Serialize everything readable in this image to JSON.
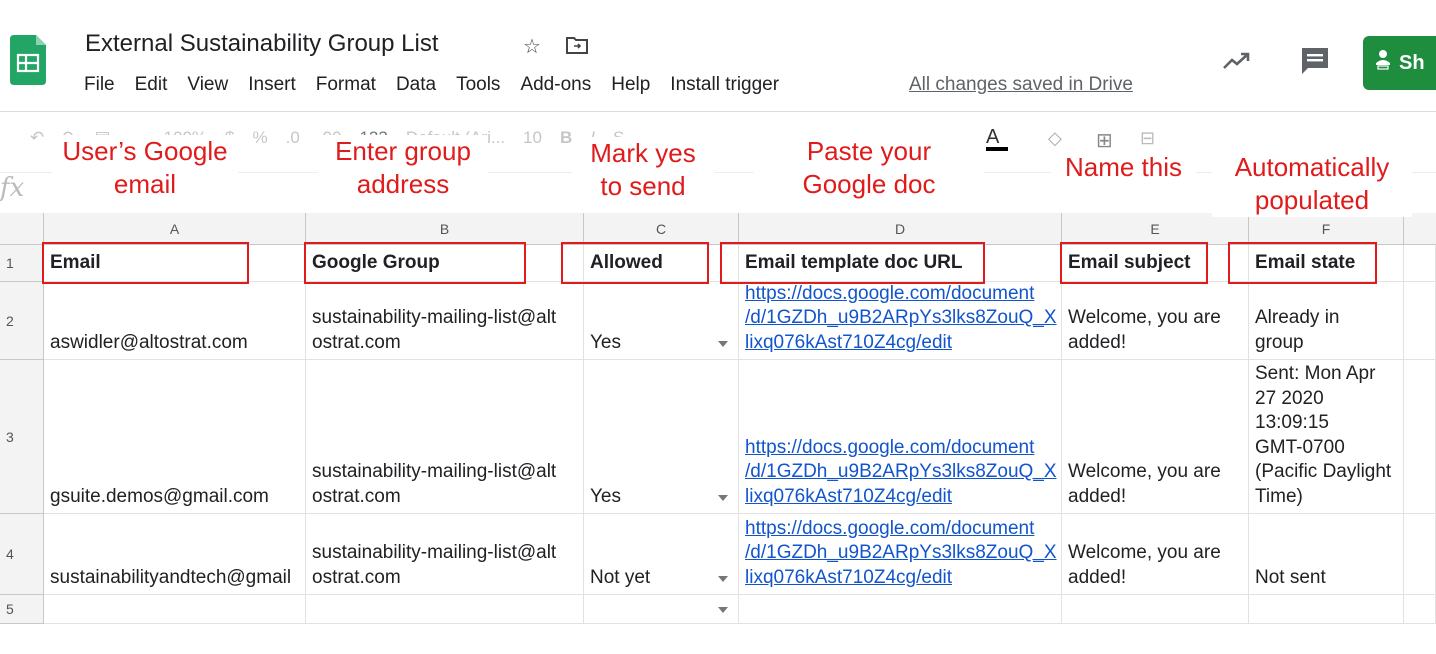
{
  "header": {
    "title": "External Sustainability Group List",
    "menu": [
      "File",
      "Edit",
      "View",
      "Insert",
      "Format",
      "Data",
      "Tools",
      "Add-ons",
      "Help",
      "Install trigger"
    ],
    "saved_status": "All changes saved in Drive",
    "share_label": "Sh",
    "colors": {
      "sheets_green": "#1e8e3e",
      "annotation_red": "#e01b1b",
      "link_blue": "#1155cc"
    }
  },
  "toolbar": {
    "zoom": "100%",
    "format_number": "123",
    "font": "Default (Ari...",
    "font_size": "10",
    "fx": "fx"
  },
  "annotations": {
    "a": "User’s Google\nemail",
    "b": "Enter group\naddress",
    "c": "Mark yes\nto send",
    "d": "Paste your\nGoogle doc",
    "e": "Name this",
    "f": "Automatically\npopulated"
  },
  "sheet": {
    "columns": [
      "A",
      "B",
      "C",
      "D",
      "E",
      "F"
    ],
    "row_numbers": [
      "1",
      "2",
      "3",
      "4",
      "5"
    ],
    "headers": [
      "Email",
      "Google Group",
      "Allowed",
      "Email template doc URL",
      "Email subject",
      "Email state"
    ],
    "rows": [
      {
        "email": "aswidler@altostrat.com",
        "group": "sustainability-mailing-list@alt\nostrat.com",
        "allowed": "Yes",
        "doc_url": "https://docs.google.com/document\n/d/1GZDh_u9B2ARpYs3lks8ZouQ_X\nlixq076kAst710Z4cg/edit",
        "subject": "Welcome, you are\nadded!",
        "state": "Already in\ngroup"
      },
      {
        "email": "gsuite.demos@gmail.com",
        "group": "sustainability-mailing-list@alt\nostrat.com",
        "allowed": "Yes",
        "doc_url": "https://docs.google.com/document\n/d/1GZDh_u9B2ARpYs3lks8ZouQ_X\nlixq076kAst710Z4cg/edit",
        "subject": "Welcome, you are\nadded!",
        "state": "Sent: Mon Apr\n27 2020\n13:09:15\nGMT-0700\n(Pacific Daylight\nTime)"
      },
      {
        "email": "sustainabilityandtech@gmail",
        "group": "sustainability-mailing-list@alt\nostrat.com",
        "allowed": "Not yet",
        "doc_url": "https://docs.google.com/document\n/d/1GZDh_u9B2ARpYs3lks8ZouQ_X\nlixq076kAst710Z4cg/edit",
        "subject": "Welcome, you are\nadded!",
        "state": "Not sent"
      }
    ]
  }
}
